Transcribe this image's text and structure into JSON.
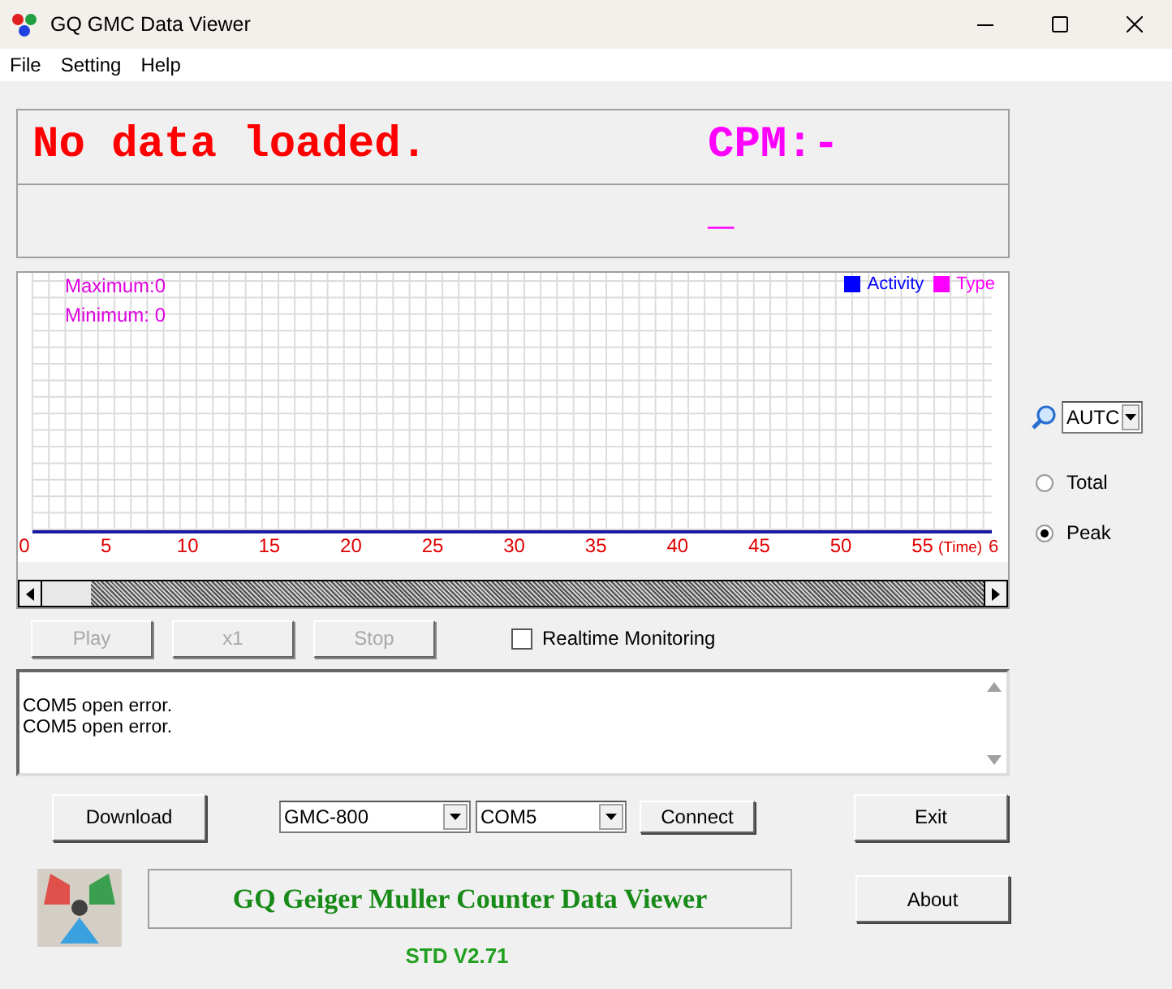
{
  "window": {
    "title": "GQ GMC Data Viewer"
  },
  "menu": [
    "File",
    "Setting",
    "Help"
  ],
  "status_panel": {
    "message": "No data loaded.",
    "cpm_label": "CPM:-",
    "cpm_value": "_"
  },
  "chart": {
    "maximum": "Maximum:0",
    "minimum": "Minimum: 0",
    "legend": [
      {
        "label": "Activity",
        "color": "#0000ff"
      },
      {
        "label": "Type",
        "color": "#ff00ff"
      }
    ],
    "x_labels": [
      "0",
      "5",
      "10",
      "15",
      "20",
      "25",
      "30",
      "35",
      "40",
      "45",
      "50",
      "55"
    ],
    "x_axis_title": "(Time)",
    "x_label_last": "6"
  },
  "zoom": {
    "value": "AUTC"
  },
  "display_mode": [
    {
      "label": "Total",
      "selected": false
    },
    {
      "label": "Peak",
      "selected": true
    }
  ],
  "playback": [
    {
      "label": "Play",
      "disabled": true
    },
    {
      "label": "x1",
      "disabled": true
    },
    {
      "label": "Stop",
      "disabled": true
    }
  ],
  "realtime": {
    "label": "Realtime Monitoring",
    "checked": false
  },
  "log": [
    "COM5 open error.",
    "COM5 open error."
  ],
  "download_button": "Download",
  "device": {
    "value": "GMC-800"
  },
  "port": {
    "value": "COM5"
  },
  "connect_button": "Connect",
  "exit_button": "Exit",
  "banner": "GQ Geiger Muller Counter Data Viewer",
  "about_button": "About",
  "version": "STD V2.71"
}
